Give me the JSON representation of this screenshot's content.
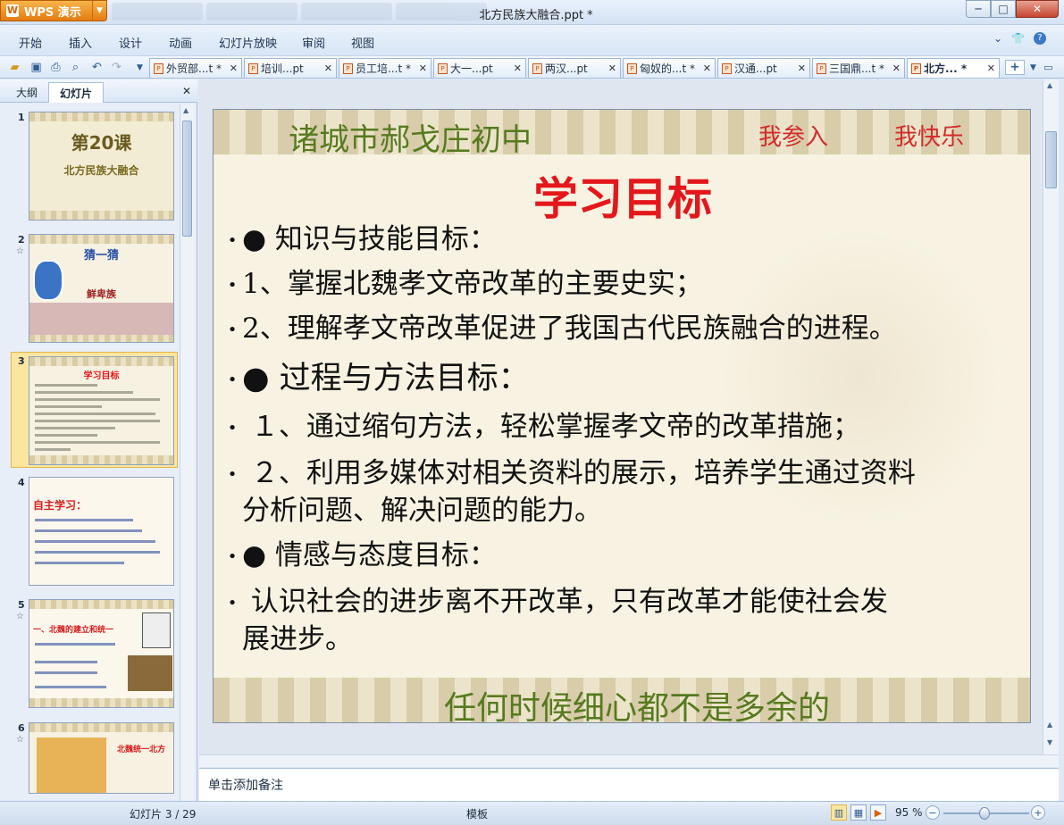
{
  "app": {
    "name": "WPS 演示",
    "window_title": "北方民族大融合.ppt *"
  },
  "window_buttons": {
    "minimize": "─",
    "maximize": "□",
    "close": "✕"
  },
  "menu": [
    "开始",
    "插入",
    "设计",
    "动画",
    "幻灯片放映",
    "审阅",
    "视图"
  ],
  "menu_right": {
    "collapse": "⌄",
    "skin": "👕",
    "help": "?"
  },
  "toolbar_icons": [
    "open-icon",
    "save-icon",
    "print-icon",
    "print-preview-icon",
    "undo-icon",
    "redo-icon",
    "customize-icon"
  ],
  "doc_tabs": [
    {
      "label": "外贸部...t *",
      "active": false
    },
    {
      "label": "培训...pt",
      "active": false
    },
    {
      "label": "员工培...t *",
      "active": false
    },
    {
      "label": "大一...pt",
      "active": false
    },
    {
      "label": "两汉...pt",
      "active": false
    },
    {
      "label": "匈奴的...t *",
      "active": false
    },
    {
      "label": "汉通...pt",
      "active": false
    },
    {
      "label": "三国鼎...t *",
      "active": false
    },
    {
      "label": "北方... *",
      "active": true
    }
  ],
  "left_panel": {
    "tabs": [
      "大纲",
      "幻灯片"
    ],
    "active_tab": "幻灯片",
    "close": "✕"
  },
  "thumbnails": [
    {
      "num": "1",
      "star": "",
      "title": "第20课",
      "sub": "北方民族大融合"
    },
    {
      "num": "2",
      "star": "☆",
      "title": "猜一猜",
      "sub": "鲜卑族"
    },
    {
      "num": "3",
      "star": "",
      "title": "学习目标",
      "sub": ""
    },
    {
      "num": "4",
      "star": "",
      "title": "自主学习：",
      "sub": ""
    },
    {
      "num": "5",
      "star": "☆",
      "title": "一、北魏的建立和统一",
      "sub": ""
    },
    {
      "num": "6",
      "star": "☆",
      "title": "北魏统一北方",
      "sub": ""
    }
  ],
  "slide": {
    "school": "诸城市郝戈庄初中",
    "motto1": "我参入",
    "motto2": "我快乐",
    "title": "学习目标",
    "bullets": [
      {
        "marker": "•",
        "text": "● 知识与技能目标："
      },
      {
        "marker": "•",
        "text": "1、掌握北魏孝文帝改革的主要史实；"
      },
      {
        "marker": "•",
        "text": "2、理解孝文帝改革促进了我国古代民族融合的进程。"
      },
      {
        "marker": "•",
        "text": "● 过程与方法目标："
      },
      {
        "marker": "•",
        "text": " １、通过缩句方法，轻松掌握孝文帝的改革措施；"
      },
      {
        "marker": "•",
        "text": " ２、利用多媒体对相关资料的展示，培养学生通过资料"
      },
      {
        "marker": "",
        "text": "分析问题、解决问题的能力。"
      },
      {
        "marker": "•",
        "text": "● 情感与态度目标："
      },
      {
        "marker": "•",
        "text": "   认识社会的进步离不开改革，只有改革才能使社会发"
      },
      {
        "marker": "",
        "text": "展进步。"
      }
    ],
    "footer": "任何时候细心都不是多余的"
  },
  "notes_placeholder": "单击添加备注",
  "status": {
    "slide_info": "幻灯片 3 / 29",
    "template": "模板",
    "zoom": "95 %",
    "zoom_level": 0.95
  }
}
